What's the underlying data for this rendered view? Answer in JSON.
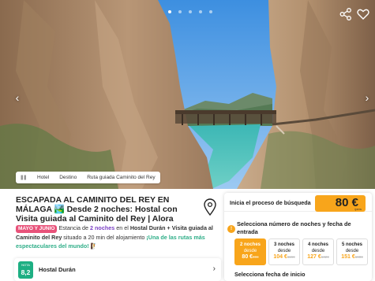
{
  "hero": {
    "breadcrumbs": [
      "Hotel",
      "Destino",
      "Ruta guiada Caminito del Rey"
    ],
    "slide_dots": 5
  },
  "listing": {
    "title": "ESCAPADA AL CAMINITO DEL REY EN MÁLAGA 🏞️ Desde 2 noches: Hostal con Visita guiada al Caminito del Rey | Alora",
    "tag": "MAYO Y JUNIO",
    "desc_1": " Estancia de ",
    "desc_nights": "2 noches",
    "desc_2": " en el ",
    "desc_bold": "Hostal Durán + Visita guiada al Caminito del Rey",
    "desc_3": " situado a 20 min del alojamiento ",
    "desc_highlight": "¡Una de las rutas más espectaculares del mundo!",
    "desc_emoji": " 🧗"
  },
  "hotel_card": {
    "rating_label": "NOTA",
    "rating": "8,2",
    "name": "Hostal Durán",
    "chevron": "›"
  },
  "booking": {
    "start_label": "Inicia el proceso de búsqueda",
    "price": "80 €",
    "price_unit": "/pers",
    "step_number": "!",
    "step_title": "Selecciona número de noches y fecha de entrada",
    "date_title": "Selecciona fecha de inicio",
    "options": [
      {
        "nights": "2 noches",
        "from": "desde",
        "price": "80 €",
        "old": "90€",
        "selected": true
      },
      {
        "nights": "3 noches",
        "from": "desde",
        "price": "104 €",
        "old": "116€",
        "selected": false
      },
      {
        "nights": "4 noches",
        "from": "desde",
        "price": "127 €",
        "old": "142€",
        "selected": false
      },
      {
        "nights": "5 noches",
        "from": "desde",
        "price": "151 €",
        "old": "168€",
        "selected": false
      }
    ]
  },
  "colors": {
    "accent": "#f8a51b",
    "rating_green": "#1eaf83",
    "tag_pink": "#e8527a",
    "highlight_purple": "#7a3fc4"
  },
  "icons": [
    "share-icon",
    "heart-icon",
    "chevron-left-icon",
    "chevron-right-icon",
    "home-icon",
    "map-pin-icon"
  ]
}
